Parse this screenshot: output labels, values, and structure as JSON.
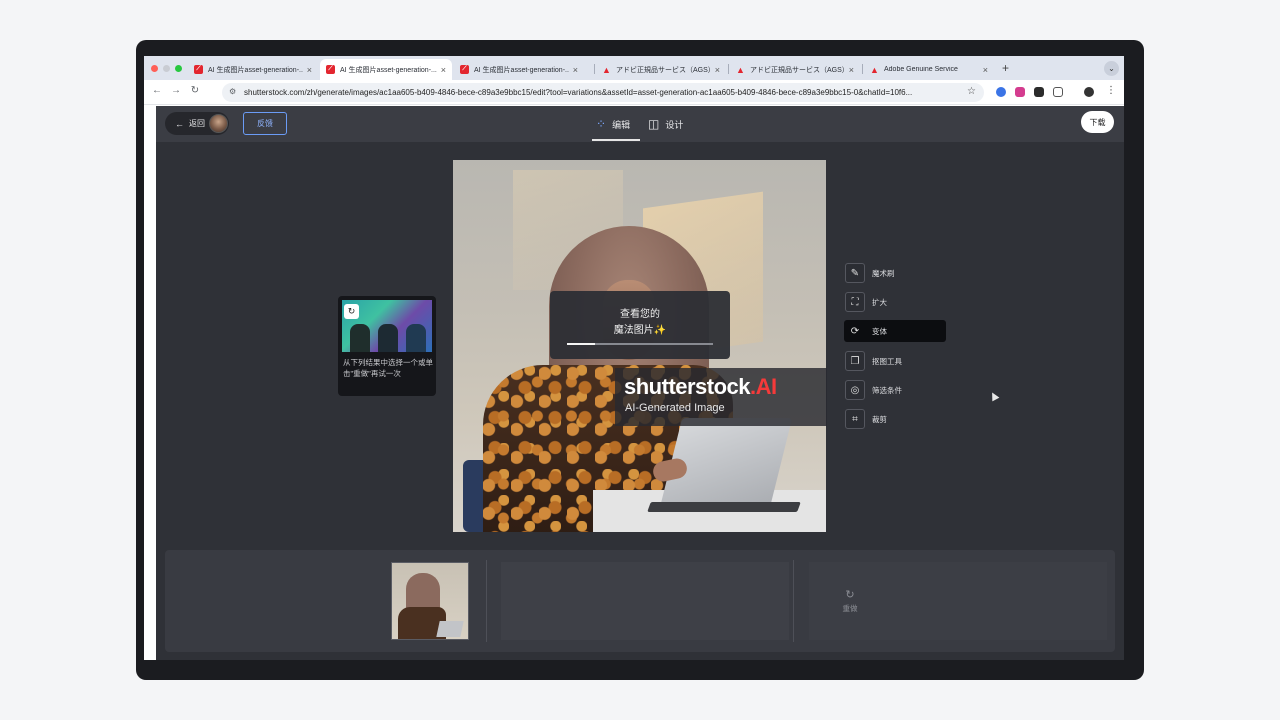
{
  "browser": {
    "tabs": [
      {
        "title": "AI 生成图片asset-generation-...",
        "favicon": "ai-logo-icon"
      },
      {
        "title": "AI 生成图片asset-generation-...",
        "favicon": "ai-logo-icon"
      },
      {
        "title": "AI 生成图片asset-generation-...",
        "favicon": "ai-logo-icon"
      },
      {
        "title": "アドビ正規品サービス（AGS）",
        "favicon": "adobe-logo-icon"
      },
      {
        "title": "アドビ正規品サービス（AGS）",
        "favicon": "adobe-logo-icon"
      },
      {
        "title": "Adobe Genuine Service",
        "favicon": "adobe-logo-icon"
      }
    ],
    "active_tab_index": 1,
    "url": "shutterstock.com/zh/generate/images/ac1aa605-b409-4846-bece-c89a3e9bbc15/edit?tool=variations&assetId=asset-generation-ac1aa605-b409-4846-bece-c89a3e9bbc15-0&chatId=10f6..."
  },
  "header": {
    "back_label": "返回",
    "feedback_label": "反馈",
    "edit_tab": "编辑",
    "design_tab": "设计",
    "download_label": "下载"
  },
  "loading": {
    "line1": "查看您的",
    "line2": "魔法图片✨",
    "progress": 0.19
  },
  "watermark": {
    "brand": "shutterstock",
    "brand_suffix": ".AI",
    "subtitle": "AI-Generated Image"
  },
  "hint": {
    "text": "从下列结果中选择一个或单击\"重做\"再试一次"
  },
  "tools": [
    {
      "label": "魔术刷",
      "icon": "magic-brush-icon"
    },
    {
      "label": "扩大",
      "icon": "expand-icon"
    },
    {
      "label": "变体",
      "icon": "variations-icon",
      "active": true
    },
    {
      "label": "抠图工具",
      "icon": "cutout-icon"
    },
    {
      "label": "筛选条件",
      "icon": "filter-icon"
    },
    {
      "label": "裁剪",
      "icon": "crop-icon"
    }
  ],
  "bottom": {
    "redo_label": "重做"
  },
  "colors": {
    "app_bg": "#2f3137",
    "header_bg": "#3b3d44",
    "accent_blue": "#6b9cf6",
    "brand_red": "#f53a3a"
  }
}
